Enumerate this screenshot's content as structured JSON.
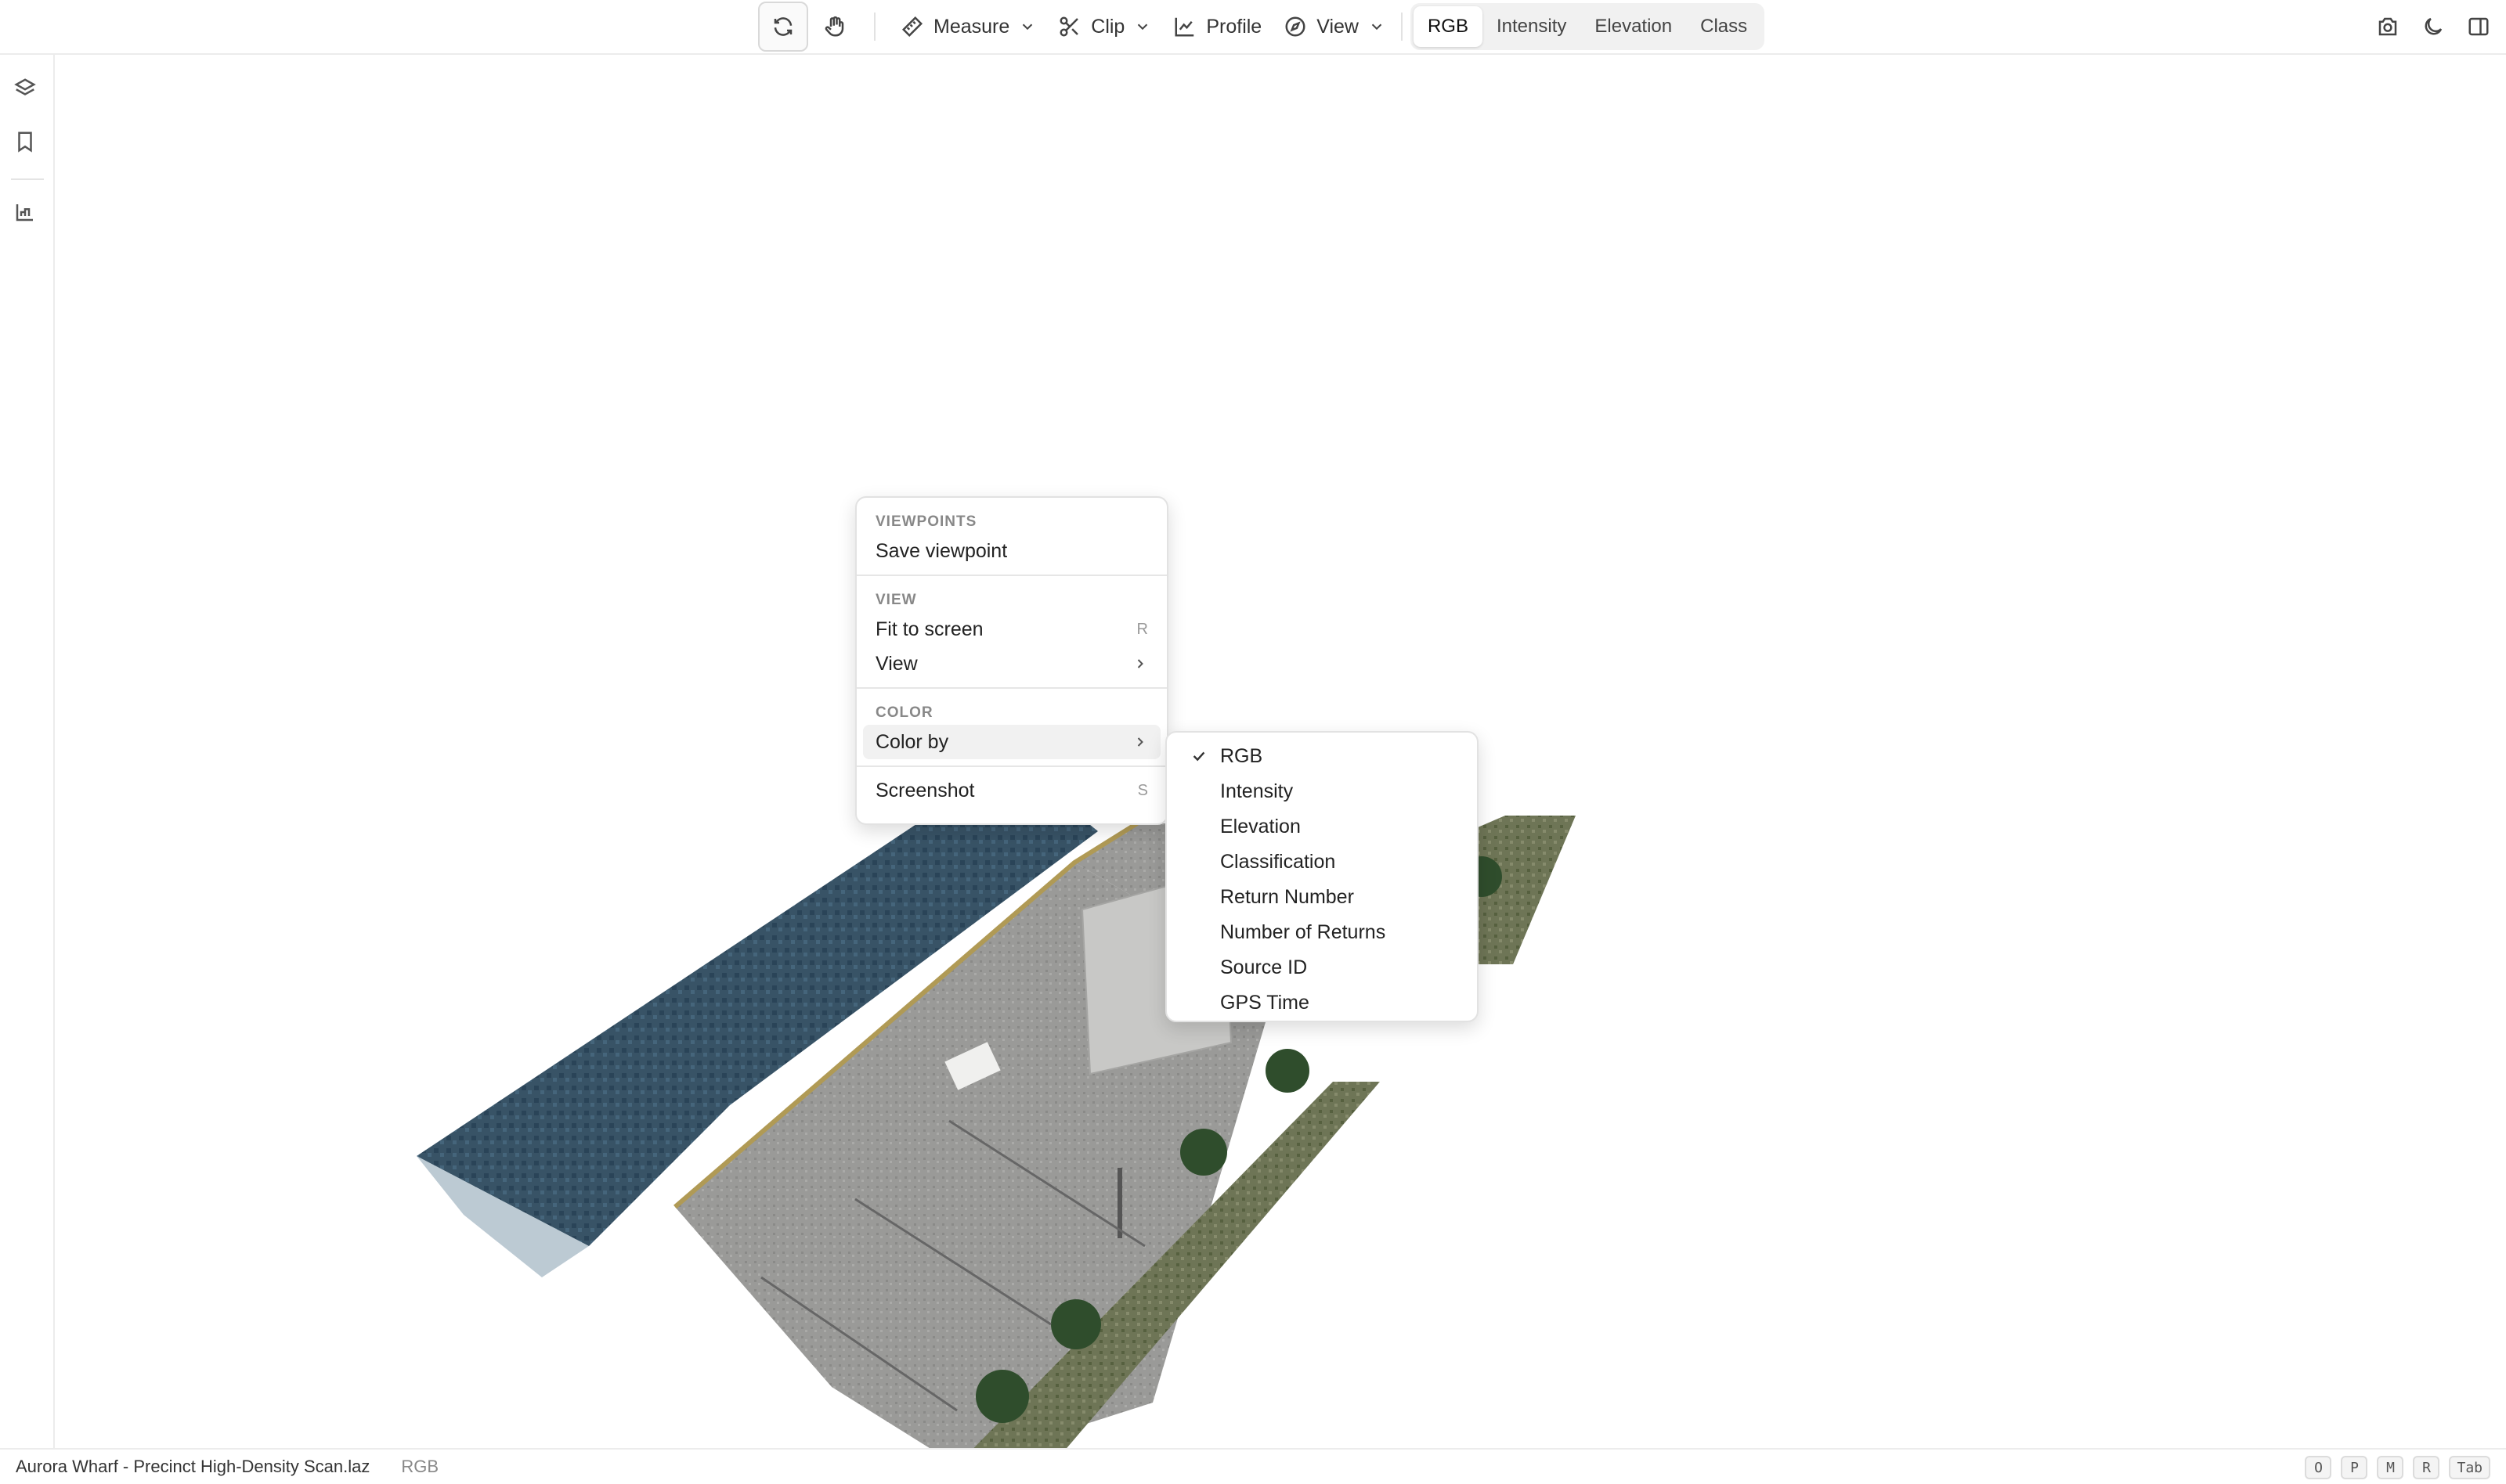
{
  "toolbar": {
    "measure_label": "Measure",
    "clip_label": "Clip",
    "profile_label": "Profile",
    "view_label": "View",
    "color_modes": [
      "RGB",
      "Intensity",
      "Elevation",
      "Class"
    ],
    "active_color_mode": "RGB"
  },
  "context_menu": {
    "viewpoints_header": "VIEWPOINTS",
    "save_viewpoint": "Save viewpoint",
    "view_header": "VIEW",
    "fit_to_screen": "Fit to screen",
    "fit_shortcut": "R",
    "view_item": "View",
    "color_header": "COLOR",
    "color_by": "Color by",
    "screenshot": "Screenshot",
    "screenshot_shortcut": "S"
  },
  "color_by_submenu": {
    "items": [
      "RGB",
      "Intensity",
      "Elevation",
      "Classification",
      "Return Number",
      "Number of Returns",
      "Source ID",
      "GPS Time"
    ],
    "checked": "RGB"
  },
  "status": {
    "file_name": "Aurora Wharf - Precinct High-Density Scan.laz",
    "color_mode": "RGB",
    "keys": [
      "O",
      "P",
      "M",
      "R",
      "Tab"
    ]
  },
  "icons": {
    "orbit": "orbit-icon",
    "pan": "hand-icon",
    "layers": "layers-icon",
    "bookmark": "bookmark-icon",
    "chart": "chart-icon",
    "camera": "camera-icon",
    "theme": "moon-icon",
    "sidebar": "sidebar-toggle-icon"
  }
}
